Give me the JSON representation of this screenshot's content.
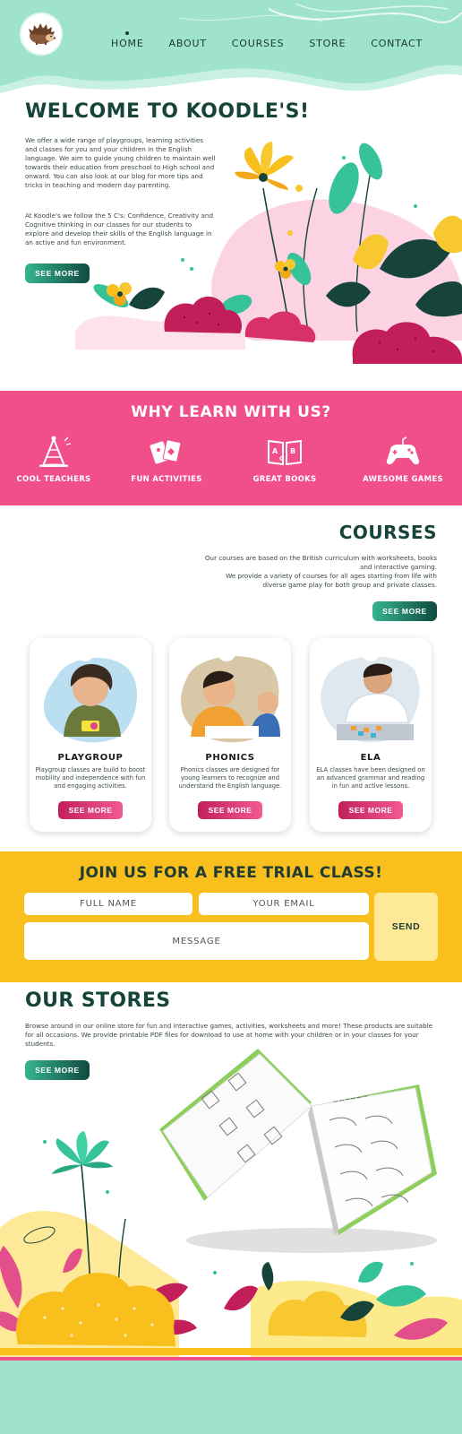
{
  "nav": {
    "home": "HOME",
    "about": "ABOUT",
    "courses": "COURSES",
    "store": "STORE",
    "contact": "CONTACT"
  },
  "welcome": {
    "title": "WELCOME TO KOODLE'S!",
    "paragraph1": "We offer a wide range of playgroups, learning activities and classes for you and your children in the English language. We aim to guide young children to maintain well towards their education from preschool to High school and onward. You can also look at our blog for more tips and tricks in teaching and modern day parenting.",
    "paragraph2": "At Koodle's we follow the 5 C's: Confidence, Creativity and Cognitive thinking in our classes for our students to explore and develop their skills of the English language in an active and fun environment.",
    "button": "SEE MORE"
  },
  "why": {
    "title": "WHY LEARN WITH US?",
    "features": [
      {
        "label": "COOL TEACHERS",
        "icon": "party-hat-icon"
      },
      {
        "label": "FUN ACTIVITIES",
        "icon": "playing-cards-icon"
      },
      {
        "label": "GREAT BOOKS",
        "icon": "open-book-icon"
      },
      {
        "label": "AWESOME GAMES",
        "icon": "game-controller-icon"
      }
    ]
  },
  "courses": {
    "title": "COURSES",
    "description_line1": "Our courses are based on the British curriculum with worksheets, books and interactive gaming.",
    "description_line2": "We provide a variety of courses for all ages starting from life with diverse game play for both group and private classes.",
    "button": "SEE MORE",
    "cards": [
      {
        "title": "PLAYGROUP",
        "description": "Playgroup classes are build to boost mobility and independence with fun and engaging activities.",
        "button": "SEE MORE"
      },
      {
        "title": "PHONICS",
        "description": "Phonics classes are designed for young learners to recognize and understand the English language.",
        "button": "SEE MORE"
      },
      {
        "title": "ELA",
        "description": "ELA classes have been designed on an advanced grammar and reading in fun and active lessons.",
        "button": "SEE MORE"
      }
    ]
  },
  "trial": {
    "title": "JOIN US FOR A FREE TRIAL CLASS!",
    "name_placeholder": "FULL NAME",
    "email_placeholder": "YOUR EMAIL",
    "message_placeholder": "MESSAGE",
    "send": "SEND"
  },
  "stores": {
    "title": "OUR STORES",
    "description": "Browse around in our online store for fun and interactive games, activities, worksheets and more! These products are suitable for all occasions. We provide printable PDF files for download to use at home with your children or in your classes for your students.",
    "button": "SEE MORE"
  },
  "colors": {
    "mint": "#9fe3cf",
    "pink": "#f14f8a",
    "yellow": "#f8bf1d",
    "dark_green": "#17443a"
  }
}
